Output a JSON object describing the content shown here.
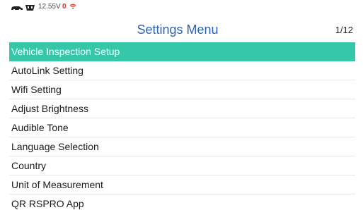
{
  "status_bar": {
    "voltage": "12.55V",
    "count": "0",
    "icons": [
      "car-icon",
      "obd-connector-icon",
      "wifi-icon"
    ],
    "count_color": "#e0301e"
  },
  "header": {
    "title": "Settings Menu",
    "page_indicator": "1/12",
    "title_color": "#2c63b5"
  },
  "menu": {
    "selected_index": 0,
    "highlight_color": "#35c7a8",
    "items": [
      {
        "label": "Vehicle Inspection Setup"
      },
      {
        "label": "AutoLink Setting"
      },
      {
        "label": "Wifi Setting"
      },
      {
        "label": "Adjust Brightness"
      },
      {
        "label": "Audible Tone"
      },
      {
        "label": "Language Selection"
      },
      {
        "label": "Country"
      },
      {
        "label": "Unit of Measurement"
      },
      {
        "label": "QR RSPRO App"
      }
    ]
  }
}
